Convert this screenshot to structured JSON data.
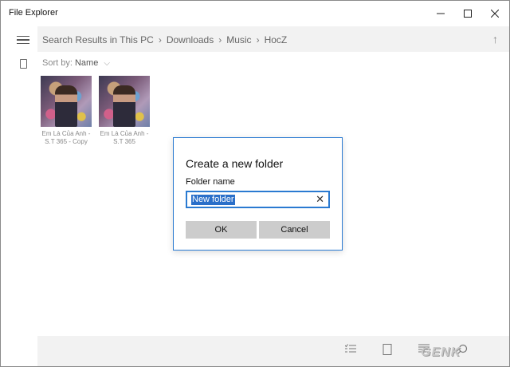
{
  "window": {
    "title": "File Explorer",
    "controls": {
      "minimize": "—",
      "maximize": "☐",
      "close": "✕"
    }
  },
  "address": {
    "crumbs": [
      "Search Results in This PC",
      "Downloads",
      "Music",
      "HocZ"
    ],
    "separator": "›",
    "up_icon": "↑"
  },
  "sort": {
    "label": "Sort by:",
    "value": "Name",
    "chevron": "⌵"
  },
  "files": [
    {
      "name": "Em Là Của Anh - S.T 365 - Copy"
    },
    {
      "name": "Em Là Của Anh - S.T 365"
    }
  ],
  "dialog": {
    "title": "Create a new folder",
    "field_label": "Folder name",
    "field_value": "New folder",
    "clear_icon": "✕",
    "ok_label": "OK",
    "cancel_label": "Cancel"
  },
  "bottombar": {
    "icons": [
      "checklist-icon",
      "tablet-icon",
      "list-icon",
      "search-icon"
    ]
  },
  "watermark": "GENK",
  "colors": {
    "accent": "#2a7ad1",
    "selection": "#2a6fc9",
    "button": "#cccccc"
  }
}
